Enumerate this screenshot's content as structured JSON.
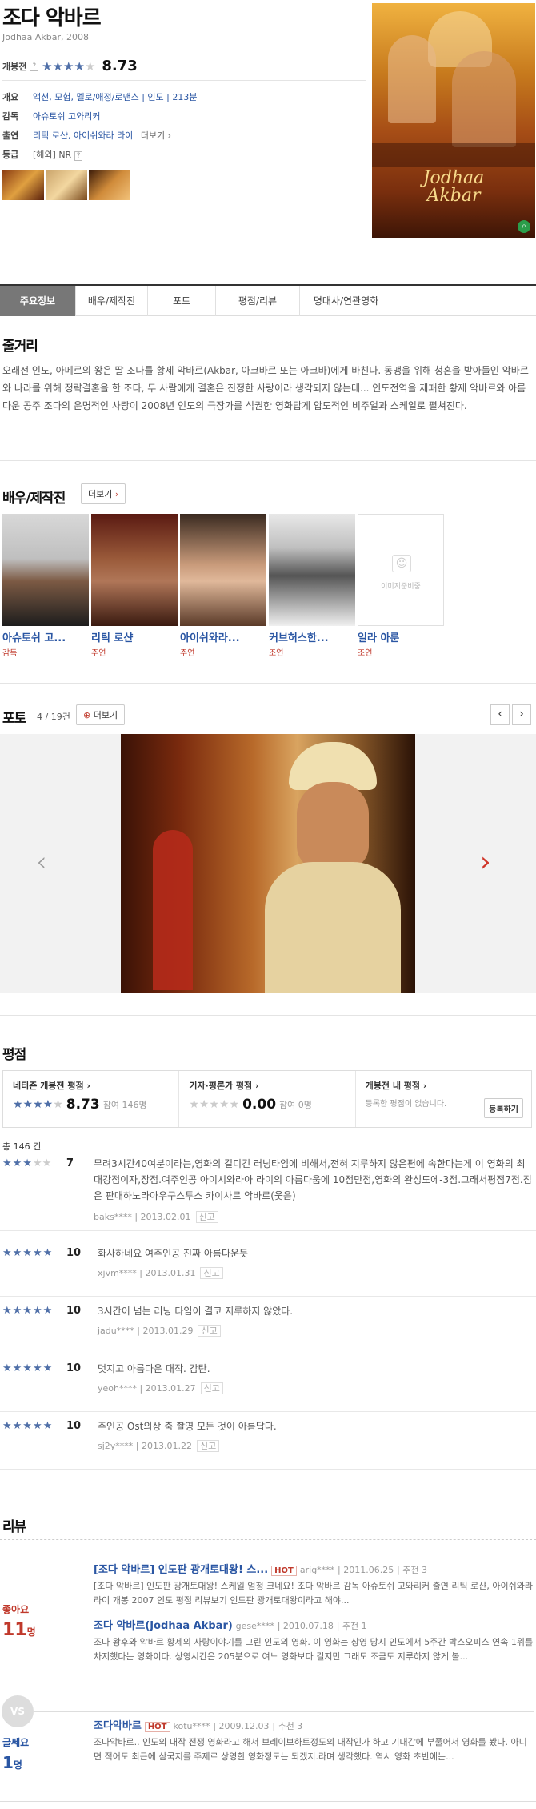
{
  "movie": {
    "title": "조다 악바르",
    "subtitle": "Jodhaa Akbar, 2008",
    "rating_label": "개봉전",
    "rating_stars": "★★★★",
    "rating_score": "8.73",
    "info": [
      {
        "label": "개요",
        "value": "액션, 모험, 멜로/애정/로맨스  |  인도  |  213분"
      },
      {
        "label": "감독",
        "value": "아슈토쉬 고와리커"
      },
      {
        "label": "출연",
        "value": "리틱 로샨, 아이쉬와라 라이",
        "more": "더보기 ›"
      },
      {
        "label": "등급",
        "value": "[해외] NR"
      }
    ],
    "poster_title_1": "Jodhaa",
    "poster_title_2": "Akbar"
  },
  "tabs": [
    {
      "label": "주요정보",
      "active": true
    },
    {
      "label": "배우/제작진"
    },
    {
      "label": "포토"
    },
    {
      "label": "평점/리뷰"
    },
    {
      "label": "명대사/연관영화"
    }
  ],
  "synopsis": {
    "heading": "줄거리",
    "text": "오래전 인도, 아메르의 왕은 딸 조다를 황제 악바르(Akbar, 아크바르 또는 아크바)에게 바친다. 동맹을 위해 청혼을 받아들인 악바르와 나라를 위해 정략결혼을 한 조다, 두 사람에게 결혼은 진정한 사랑이라 생각되지 않는데... 인도전역을 제패한 황제 악바르와 아름다운 공주 조다의 운명적인 사랑이 2008년 인도의 극장가를 석권한 영화답게 압도적인 비주얼과 스케일로 펼쳐진다."
  },
  "cast": {
    "heading": "배우/제작진",
    "more": "더보기",
    "members": [
      {
        "name": "아슈토쉬 고...",
        "role": "감독"
      },
      {
        "name": "리틱 로샨",
        "role": "주연"
      },
      {
        "name": "아이쉬와라...",
        "role": "주연"
      },
      {
        "name": "커브허스한...",
        "role": "조연"
      },
      {
        "name": "일라 아룬",
        "role": "조연"
      }
    ],
    "placeholder": "이미지준비중"
  },
  "photos": {
    "heading": "포토",
    "count": "4 / 19건",
    "more": "더보기"
  },
  "ratings": {
    "heading": "평점",
    "netizen": {
      "label": "네티즌 개봉전 평점 ›",
      "stars": "★★★★",
      "score": "8.73",
      "count": "참여 146명"
    },
    "critic": {
      "label": "기자·평론가 평점 ›",
      "stars": "★★★★★",
      "score": "0.00",
      "count": "참여 0명"
    },
    "mine": {
      "label": "개봉전 내 평점 ›",
      "desc": "등록한 평점이 없습니다.",
      "button": "등록하기"
    },
    "total": "총 146 건",
    "items": [
      {
        "stars": "★★★",
        "score": "7",
        "text": "무려3시간40여분이라는,영화의 길디긴 러닝타임에 비해서,전혀 지루하지 않은편에 속한다는게 이 영화의 최대강점이자,장점.여주인공 아이시와라아 라이의 아름다움에 10점만점,영화의 완성도에-3점.그래서평점7점.짐은 판매하노라아우구스투스 카이사르 악바르(웃음)",
        "user": "baks****",
        "date": "2013.02.01",
        "report": "신고"
      },
      {
        "stars": "★★★★★",
        "score": "10",
        "text": "화사하네요 여주인공 진짜 아름다운듯",
        "user": "xjvm****",
        "date": "2013.01.31",
        "report": "신고"
      },
      {
        "stars": "★★★★★",
        "score": "10",
        "text": "3시간이 넘는 러닝 타임이 결코 지루하지 않았다.",
        "user": "jadu****",
        "date": "2013.01.29",
        "report": "신고"
      },
      {
        "stars": "★★★★★",
        "score": "10",
        "text": "멋지고 아름다운 대작. 감탄.",
        "user": "yeoh****",
        "date": "2013.01.27",
        "report": "신고"
      },
      {
        "stars": "★★★★★",
        "score": "10",
        "text": "주인공 Ost의상 춤 촬영 모든 것이 아름답다.",
        "user": "sj2y****",
        "date": "2013.01.22",
        "report": "신고"
      }
    ]
  },
  "reviews": {
    "heading": "리뷰",
    "like_label": "좋아요",
    "like_count": "11",
    "like_unit": "명",
    "dislike_label": "글쎄요",
    "dislike_count": "1",
    "dislike_unit": "명",
    "vs": "VS",
    "items": [
      {
        "title": "[조다 악바르] 인도판 광개토대왕! 스...",
        "hot": "HOT",
        "user": "arig****",
        "date": "2011.06.25",
        "rec": "추천 3",
        "text": "[조다 악바르] 인도판 광개토대왕! 스케일 엄청 크네요! 조다 악바르 감독 아슈토쉬 고와리커 출연 리틱 로샨, 아이쉬와라 라이 개봉 2007 인도 평점 리뷰보기 인도판 광개토대왕이라고 해야..."
      },
      {
        "title": "조다 악바르(Jodhaa Akbar)",
        "hot": "",
        "user": "gese****",
        "date": "2010.07.18",
        "rec": "추천 1",
        "text": "조다 왕후와 악바르 황제의 사랑이야기를 그린 인도의 영화. 이 영화는 상영 당시 인도에서 5주간 박스오피스 연속 1위를 차지했다는 영화이다. 상영시간은 205분으로 여느 영화보다 길지만 그래도 조금도 지루하지 않게 볼..."
      },
      {
        "title": "조다악바르",
        "hot": "HOT",
        "user": "kotu****",
        "date": "2009.12.03",
        "rec": "추천 3",
        "text": "조다악바르.. 인도의 대작 전쟁 영화라고 해서 브레이브하트정도의 대작인가 하고 기대감에 부풀어서 영화를 봤다. 아니면 적어도 최근에 삼국지를 주제로 상영한 영화정도는 되겠지.라며 생각했다. 역시 영화 초반에는..."
      }
    ]
  },
  "colors": {
    "accent": "#2a56a3",
    "tab_active": "#777777",
    "red": "#c0392b"
  }
}
